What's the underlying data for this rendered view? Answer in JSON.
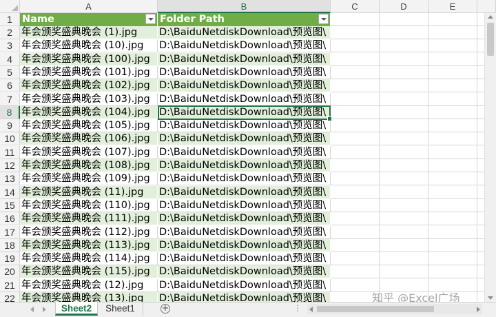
{
  "column_headers": [
    "A",
    "B",
    "C",
    "D",
    "E"
  ],
  "table_header": {
    "name": "Name",
    "folder_path": "Folder Path"
  },
  "rows": [
    {
      "num": "1"
    },
    {
      "num": "2",
      "name": "年会颁奖盛典晚会 (1).jpg",
      "path": "D:\\BaiduNetdiskDownload\\预览图\\"
    },
    {
      "num": "3",
      "name": "年会颁奖盛典晚会 (10).jpg",
      "path": "D:\\BaiduNetdiskDownload\\预览图\\"
    },
    {
      "num": "4",
      "name": "年会颁奖盛典晚会 (100).jpg",
      "path": "D:\\BaiduNetdiskDownload\\预览图\\"
    },
    {
      "num": "5",
      "name": "年会颁奖盛典晚会 (101).jpg",
      "path": "D:\\BaiduNetdiskDownload\\预览图\\"
    },
    {
      "num": "6",
      "name": "年会颁奖盛典晚会 (102).jpg",
      "path": "D:\\BaiduNetdiskDownload\\预览图\\"
    },
    {
      "num": "7",
      "name": "年会颁奖盛典晚会 (103).jpg",
      "path": "D:\\BaiduNetdiskDownload\\预览图\\"
    },
    {
      "num": "8",
      "name": "年会颁奖盛典晚会 (104).jpg",
      "path": "D:\\BaiduNetdiskDownload\\预览图\\"
    },
    {
      "num": "9",
      "name": "年会颁奖盛典晚会 (105).jpg",
      "path": "D:\\BaiduNetdiskDownload\\预览图\\"
    },
    {
      "num": "10",
      "name": "年会颁奖盛典晚会 (106).jpg",
      "path": "D:\\BaiduNetdiskDownload\\预览图\\"
    },
    {
      "num": "11",
      "name": "年会颁奖盛典晚会 (107).jpg",
      "path": "D:\\BaiduNetdiskDownload\\预览图\\"
    },
    {
      "num": "12",
      "name": "年会颁奖盛典晚会 (108).jpg",
      "path": "D:\\BaiduNetdiskDownload\\预览图\\"
    },
    {
      "num": "13",
      "name": "年会颁奖盛典晚会 (109).jpg",
      "path": "D:\\BaiduNetdiskDownload\\预览图\\"
    },
    {
      "num": "14",
      "name": "年会颁奖盛典晚会 (11).jpg",
      "path": "D:\\BaiduNetdiskDownload\\预览图\\"
    },
    {
      "num": "15",
      "name": "年会颁奖盛典晚会 (110).jpg",
      "path": "D:\\BaiduNetdiskDownload\\预览图\\"
    },
    {
      "num": "16",
      "name": "年会颁奖盛典晚会 (111).jpg",
      "path": "D:\\BaiduNetdiskDownload\\预览图\\"
    },
    {
      "num": "17",
      "name": "年会颁奖盛典晚会 (112).jpg",
      "path": "D:\\BaiduNetdiskDownload\\预览图\\"
    },
    {
      "num": "18",
      "name": "年会颁奖盛典晚会 (113).jpg",
      "path": "D:\\BaiduNetdiskDownload\\预览图\\"
    },
    {
      "num": "19",
      "name": "年会颁奖盛典晚会 (114).jpg",
      "path": "D:\\BaiduNetdiskDownload\\预览图\\"
    },
    {
      "num": "20",
      "name": "年会颁奖盛典晚会 (115).jpg",
      "path": "D:\\BaiduNetdiskDownload\\预览图\\"
    },
    {
      "num": "21",
      "name": "年会颁奖盛典晚会 (12).jpg",
      "path": "D:\\BaiduNetdiskDownload\\预览图\\"
    },
    {
      "num": "22",
      "name": "年会颁奖盛典晚会 (13).jpg",
      "path": "D:\\BaiduNetdiskDownload\\预览图\\"
    }
  ],
  "selected_cell": "B8",
  "sheet_tabs": [
    {
      "label": "Sheet2",
      "active": true
    },
    {
      "label": "Sheet1",
      "active": false
    }
  ],
  "add_sheet_symbol": "+",
  "overflow_dots": "⋮",
  "watermark": "知乎 @Excel广场",
  "colors": {
    "accent": "#217346",
    "table_header": "#70ad47",
    "band": "#e2efda"
  }
}
